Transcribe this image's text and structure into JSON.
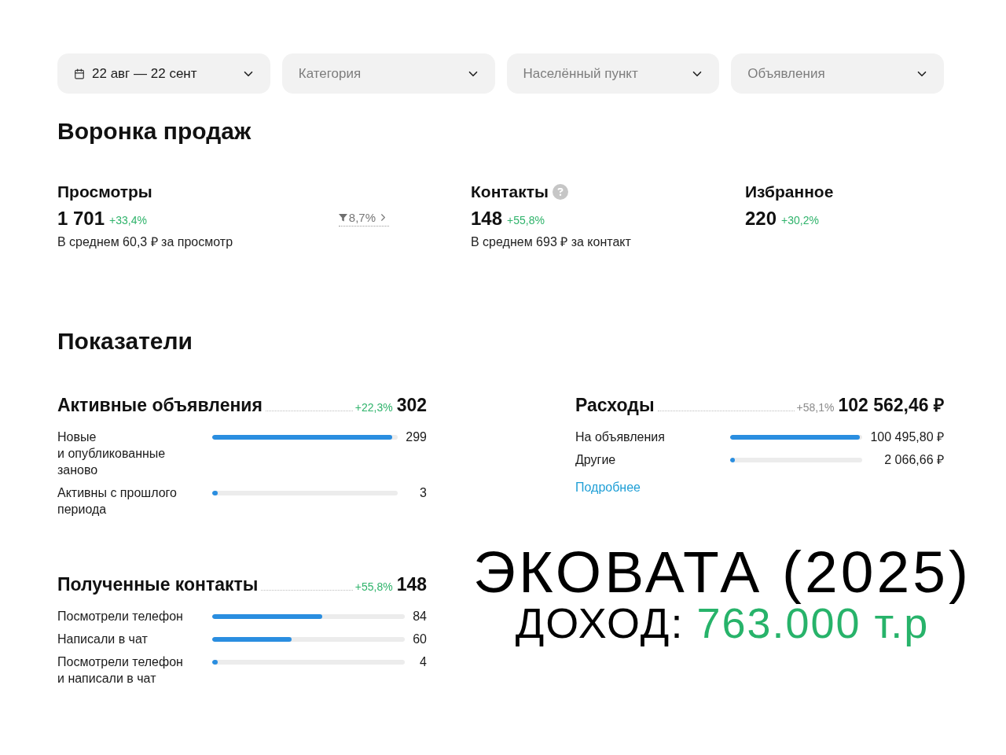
{
  "filters": [
    {
      "kind": "date",
      "value": "22 авг — 22 сент"
    },
    {
      "kind": "select",
      "placeholder": "Категория"
    },
    {
      "kind": "select",
      "placeholder": "Населённый пункт"
    },
    {
      "kind": "select",
      "placeholder": "Объявления"
    }
  ],
  "funnel": {
    "title": "Воронка продаж",
    "stages": [
      {
        "title": "Просмотры",
        "help": false,
        "value": "1 701",
        "change": "+33,4%",
        "note": "В среднем 60,3 ₽ за просмотр",
        "conversion": "8,7%"
      },
      {
        "title": "Контакты",
        "help": true,
        "value": "148",
        "change": "+55,8%",
        "note": "В среднем 693 ₽ за контакт"
      },
      {
        "title": "Избранное",
        "help": false,
        "value": "220",
        "change": "+30,2%"
      }
    ]
  },
  "metrics": {
    "title": "Показатели",
    "groups": [
      {
        "title": "Активные объявления",
        "change": "+22,3%",
        "favorable": true,
        "total": "302",
        "rows": [
          {
            "label": "Новые и опубликованные заново",
            "level": 0.97,
            "value": "299"
          },
          {
            "label": "Активны с прошлого периода",
            "level": 0.03,
            "value": "3"
          }
        ]
      },
      {
        "title": "Расходы",
        "change": "+58,1%",
        "favorable": false,
        "total": "102 562,46 ₽",
        "rows": [
          {
            "label": "На объявления",
            "level": 0.98,
            "value": "100 495,80 ₽"
          },
          {
            "label": "Другие",
            "level": 0.02,
            "value": "2 066,66 ₽"
          }
        ],
        "link": "Подробнее"
      },
      {
        "title": "Полученные контакты",
        "change": "+55,8%",
        "favorable": true,
        "total": "148",
        "rows": [
          {
            "label": "Посмотрели телефон",
            "level": 0.57,
            "value": "84"
          },
          {
            "label": "Написали в чат",
            "level": 0.41,
            "value": "60"
          },
          {
            "label": "Посмотрели телефон и написали в чат",
            "level": 0.03,
            "value": "4"
          }
        ]
      }
    ]
  },
  "overlay": {
    "title": "ЭКОВАТА (2025)",
    "income_label": "ДОХОД:",
    "income_value": "763.000 т.р"
  }
}
